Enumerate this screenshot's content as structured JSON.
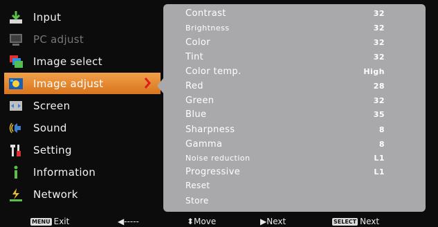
{
  "menu": {
    "items": [
      {
        "label": "Input",
        "icon": "input-icon"
      },
      {
        "label": "PC adjust",
        "icon": "pc-adjust-icon"
      },
      {
        "label": "Image select",
        "icon": "image-select-icon"
      },
      {
        "label": "Image adjust",
        "icon": "image-adjust-icon"
      },
      {
        "label": "Screen",
        "icon": "screen-icon"
      },
      {
        "label": "Sound",
        "icon": "sound-icon"
      },
      {
        "label": "Setting",
        "icon": "setting-icon"
      },
      {
        "label": "Information",
        "icon": "information-icon"
      },
      {
        "label": "Network",
        "icon": "network-icon"
      }
    ]
  },
  "adjust": {
    "rows": [
      {
        "label": "Contrast",
        "value": "32"
      },
      {
        "label": "Brightness",
        "value": "32"
      },
      {
        "label": "Color",
        "value": "32"
      },
      {
        "label": "Tint",
        "value": "32"
      },
      {
        "label": "Color temp.",
        "value": "High"
      },
      {
        "label": "Red",
        "value": "28"
      },
      {
        "label": "Green",
        "value": "32"
      },
      {
        "label": "Blue",
        "value": "35"
      },
      {
        "label": "Sharpness",
        "value": "8"
      },
      {
        "label": "Gamma",
        "value": "8"
      },
      {
        "label": "Noise reduction",
        "value": "L1"
      },
      {
        "label": "Progressive",
        "value": "L1"
      }
    ],
    "reset": "Reset",
    "store": "Store"
  },
  "bottom": {
    "menu_key": "MENU",
    "exit": "Exit",
    "back": "◀-----",
    "move": "⬍Move",
    "next": "▶Next",
    "select_key": "SELECT",
    "select_next": "Next"
  },
  "colors": {
    "background": "#0c0c0c",
    "panel": "#a9a9ab",
    "selected": "#e88a30",
    "arrow": "#e01b1b"
  }
}
